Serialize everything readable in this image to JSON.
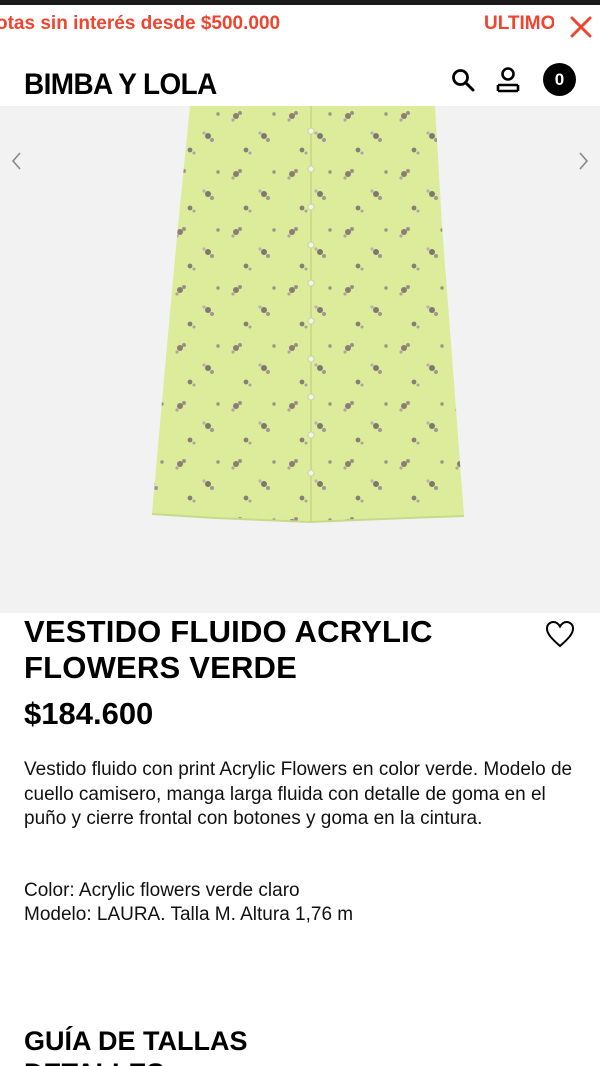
{
  "promo": {
    "text": "otas sin interés desde $500.000",
    "text_2": "ULTIMOS DÍAS",
    "color": "#f0442f"
  },
  "header": {
    "logo": "BIMBA Y LOLA",
    "cart_count": "0"
  },
  "icons": {
    "close": "close-icon",
    "search": "search-icon",
    "account": "user-icon",
    "cart": "cart-icon",
    "prev": "chevron-left-icon",
    "next": "chevron-right-icon",
    "wishlist": "heart-icon"
  },
  "product": {
    "title": "VESTIDO FLUIDO ACRYLIC FLOWERS VERDE",
    "price": "$184.600",
    "description": "Vestido fluido con print Acrylic Flowers en color verde. Modelo de cuello camisero, manga larga fluida con detalle de goma en el puño y cierre frontal con botones y goma en la cintura.",
    "color_line": "Color: Acrylic flowers verde claro",
    "model_line": "Modelo: LAURA. Talla M. Altura 1,76 m"
  },
  "sections": {
    "size_guide": "GUÍA DE TALLAS",
    "details": "DETALLES"
  },
  "colors": {
    "dress": "#dcec9a",
    "gallery_bg": "#f2f2f2"
  }
}
